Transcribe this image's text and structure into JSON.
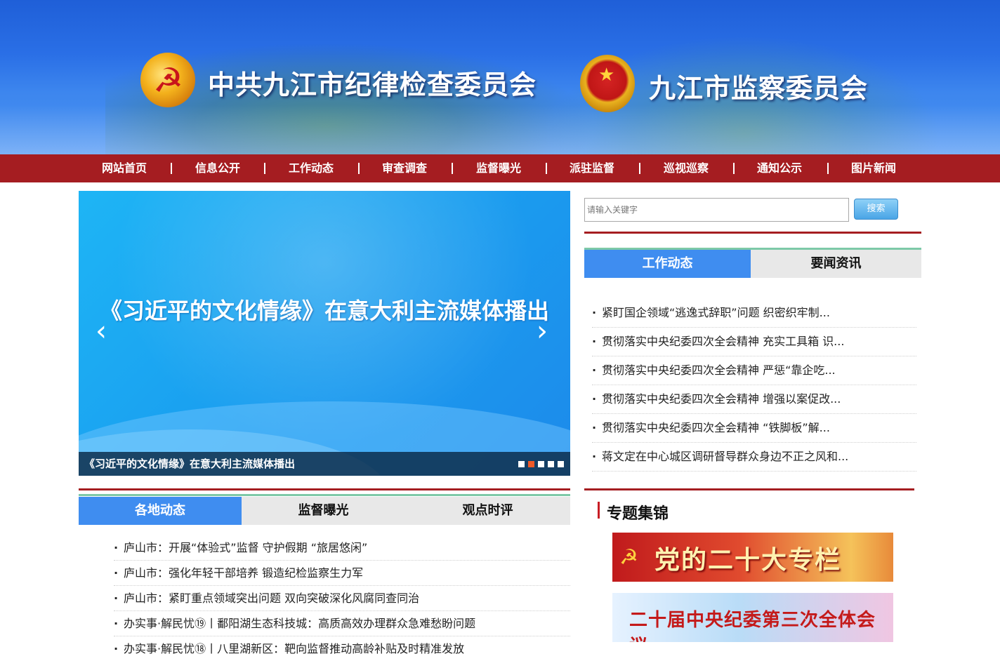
{
  "header": {
    "title_left": "中共九江市纪律检查委员会",
    "title_right": "九江市监察委员会",
    "left_emblem_icon": "party-emblem-icon",
    "right_emblem_icon": "national-emblem-icon"
  },
  "nav": {
    "items": [
      "网站首页",
      "信息公开",
      "工作动态",
      "审查调查",
      "监督曝光",
      "派驻监督",
      "巡视巡察",
      "通知公示",
      "图片新闻"
    ]
  },
  "slider": {
    "headline": "《习近平的文化情缘》在意大利主流媒体播出",
    "caption": "《习近平的文化情缘》在意大利主流媒体播出",
    "prev_icon": "chevron-left-icon",
    "next_icon": "chevron-right-icon",
    "dots": 5,
    "active_dot": 2
  },
  "search": {
    "placeholder": "请输入关键字",
    "button_label": "搜索"
  },
  "right_tabs": {
    "tabs": [
      "工作动态",
      "要闻资讯"
    ],
    "active": 0,
    "items": [
      "紧盯国企领域“逃逸式辞职”问题 织密织牢制...",
      "贯彻落实中央纪委四次全会精神 充实工具箱 识...",
      "贯彻落实中央纪委四次全会精神 严惩“靠企吃...",
      "贯彻落实中央纪委四次全会精神 增强以案促改...",
      "贯彻落实中央纪委四次全会精神 “铁脚板”解...",
      "蒋文定在中心城区调研督导群众身边不正之风和..."
    ]
  },
  "left_tabs": {
    "tabs": [
      "各地动态",
      "监督曝光",
      "观点时评"
    ],
    "active": 0,
    "items": [
      "庐山市：开展“体验式”监督 守护假期 “旅居悠闲”",
      "庐山市：强化年轻干部培养 锻造纪检监察生力军",
      "庐山市：紧盯重点领域突出问题 双向突破深化风腐同查同治",
      "办实事·解民忧⑲丨鄱阳湖生态科技城：高质高效办理群众急难愁盼问题",
      "办实事·解民忧⑱丨八里湖新区：靶向监督推动高龄补贴及时精准发放"
    ]
  },
  "topics": {
    "heading": "专题集锦",
    "banner1_text": "党的二十大专栏",
    "banner2_text": "二十届中央纪委第三次全体会议"
  },
  "colors": {
    "nav_bg": "#a51d21",
    "tab_active": "#3f8df0",
    "banner_blue": "#2a6fe6"
  }
}
